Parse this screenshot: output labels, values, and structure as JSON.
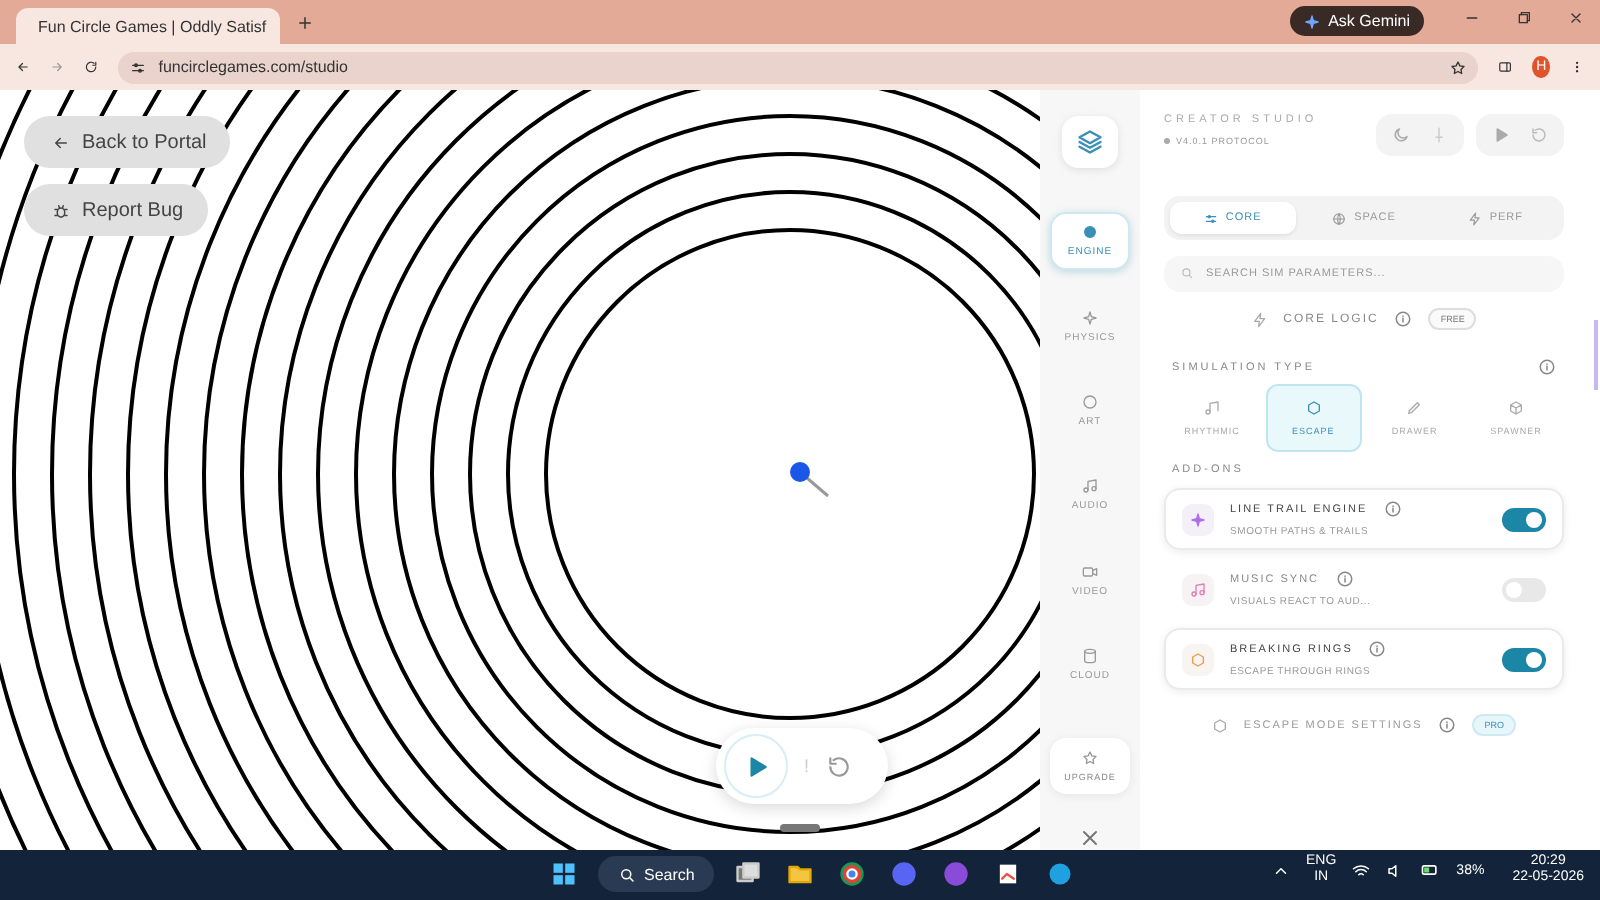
{
  "browser": {
    "tab_title": "Fun Circle Games | Oddly Satisf",
    "url": "funcirclegames.com/studio",
    "gemini_button": "Ask Gemini",
    "profile_initial": "H"
  },
  "canvas": {
    "buttons": [
      {
        "kind": "back",
        "label": "Back to Portal"
      },
      {
        "kind": "bug",
        "label": "Report Bug"
      }
    ],
    "separator": "!"
  },
  "sidebar": {
    "items": [
      {
        "kind": "engine",
        "label": "ENGINE",
        "selected": true
      },
      {
        "kind": "physics",
        "label": "PHYSICS",
        "selected": false
      },
      {
        "kind": "art",
        "label": "ART",
        "selected": false
      },
      {
        "kind": "audio",
        "label": "AUDIO",
        "selected": false
      },
      {
        "kind": "video",
        "label": "VIDEO",
        "selected": false
      },
      {
        "kind": "cloud",
        "label": "CLOUD",
        "selected": false
      }
    ],
    "upgrade": "UPGRADE"
  },
  "panel": {
    "title": "CREATOR STUDIO",
    "version": "V4.0.1 PROTOCOL",
    "tabs": [
      {
        "kind": "core",
        "label": "CORE",
        "selected": true
      },
      {
        "kind": "space",
        "label": "SPACE",
        "selected": false
      },
      {
        "kind": "perf",
        "label": "PERF",
        "selected": false
      }
    ],
    "search": {
      "placeholder": "SEARCH SIM PARAMETERS..."
    },
    "core_logic": {
      "title": "CORE LOGIC",
      "badge": "FREE"
    },
    "simulation_type": {
      "title": "SIMULATION TYPE",
      "options": [
        {
          "kind": "rhythmic",
          "label": "RHYTHMIC",
          "selected": false
        },
        {
          "kind": "escape",
          "label": "ESCAPE",
          "selected": true
        },
        {
          "kind": "drawer",
          "label": "DRAWER",
          "selected": false
        },
        {
          "kind": "spawner",
          "label": "SPAWNER",
          "selected": false
        }
      ]
    },
    "addons": {
      "title": "ADD-ONS",
      "items": [
        {
          "kind": "trail",
          "name": "LINE TRAIL ENGINE",
          "description": "SMOOTH PATHS & TRAILS",
          "on": true
        },
        {
          "kind": "music",
          "name": "MUSIC SYNC",
          "description": "VISUALS REACT TO AUD...",
          "on": false
        },
        {
          "kind": "rings",
          "name": "BREAKING RINGS",
          "description": "ESCAPE THROUGH RINGS",
          "on": true
        }
      ]
    },
    "escape_settings": {
      "title": "ESCAPE MODE SETTINGS",
      "badge": "PRO"
    }
  },
  "taskbar": {
    "search": "Search",
    "language": "ENG",
    "region": "IN",
    "battery": "38%",
    "time": "20:29",
    "date": "22-05-2026"
  }
}
